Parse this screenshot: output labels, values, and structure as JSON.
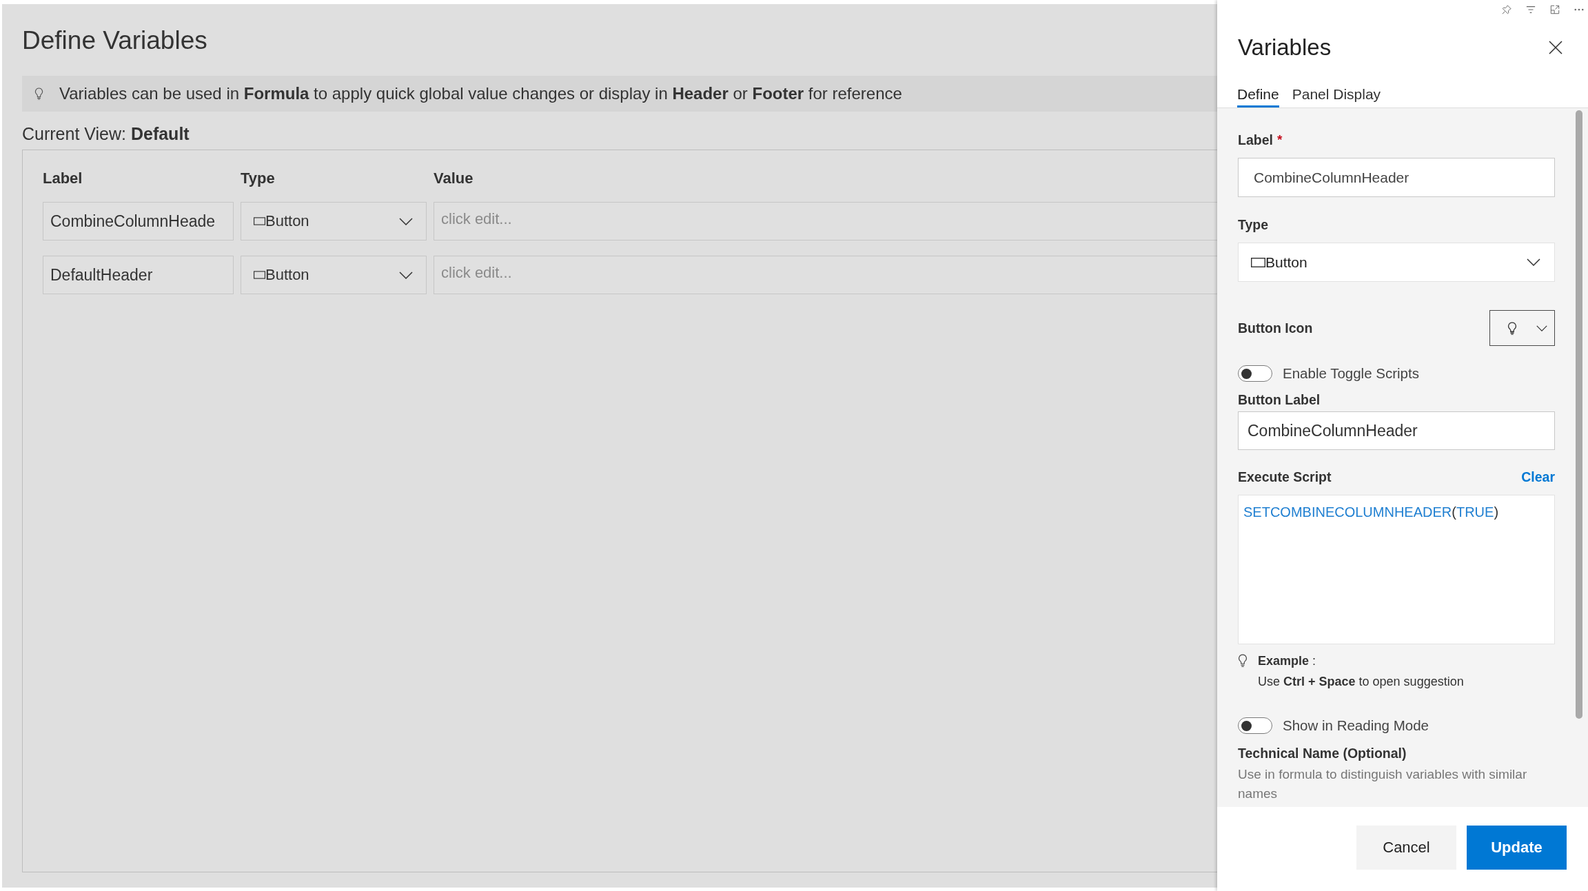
{
  "main": {
    "title": "Define Variables",
    "info": "Variables can be used in **Formula** to apply quick global value changes or display in **Header** or **Footer** for reference",
    "current_view": "Current View: **Default**",
    "table": {
      "columns": [
        "Label",
        "Type",
        "Value"
      ],
      "rows": [
        {
          "label": "CombineColumnHeade",
          "type": "Button",
          "placeholder": "click edit..."
        },
        {
          "label": "DefaultHeader",
          "type": "Button",
          "placeholder": "click edit..."
        }
      ]
    }
  },
  "panel": {
    "title": "Variables",
    "tabs": [
      {
        "label": "Define",
        "selected": true
      },
      {
        "label": "Panel Display",
        "selected": false
      }
    ],
    "fields": [
      {
        "kind": "text",
        "label": "Label",
        "required_mark": "*",
        "value": "CombineColumnHeader"
      },
      {
        "kind": "select",
        "label": "Type",
        "value": "Button"
      },
      {
        "kind": "icon_picker",
        "label": "Button Icon"
      },
      {
        "kind": "toggle",
        "label": "Enable Toggle Scripts",
        "on": false
      },
      {
        "kind": "text",
        "label": "Button Label",
        "value": "CombineColumnHeader"
      },
      {
        "kind": "script",
        "label": "Execute Script",
        "action": "Clear",
        "tokens": [
          {
            "kind": "function",
            "text": "SETCOMBINECOLUMNHEADER"
          },
          {
            "kind": "punct",
            "text": "("
          },
          {
            "kind": "keyword",
            "text": "TRUE"
          },
          {
            "kind": "punct",
            "text": ")"
          }
        ]
      },
      {
        "kind": "hint",
        "title": "**Example** :",
        "text": "Use **Ctrl + Space** to open suggestion"
      },
      {
        "kind": "toggle",
        "label": "Show in Reading Mode",
        "on": false
      },
      {
        "kind": "description",
        "label": "Technical Name (Optional)",
        "text": "Use in formula to distinguish variables with similar names"
      }
    ],
    "buttons": [
      {
        "label": "Cancel",
        "kind": "secondary"
      },
      {
        "label": "Update",
        "kind": "primary"
      }
    ]
  }
}
